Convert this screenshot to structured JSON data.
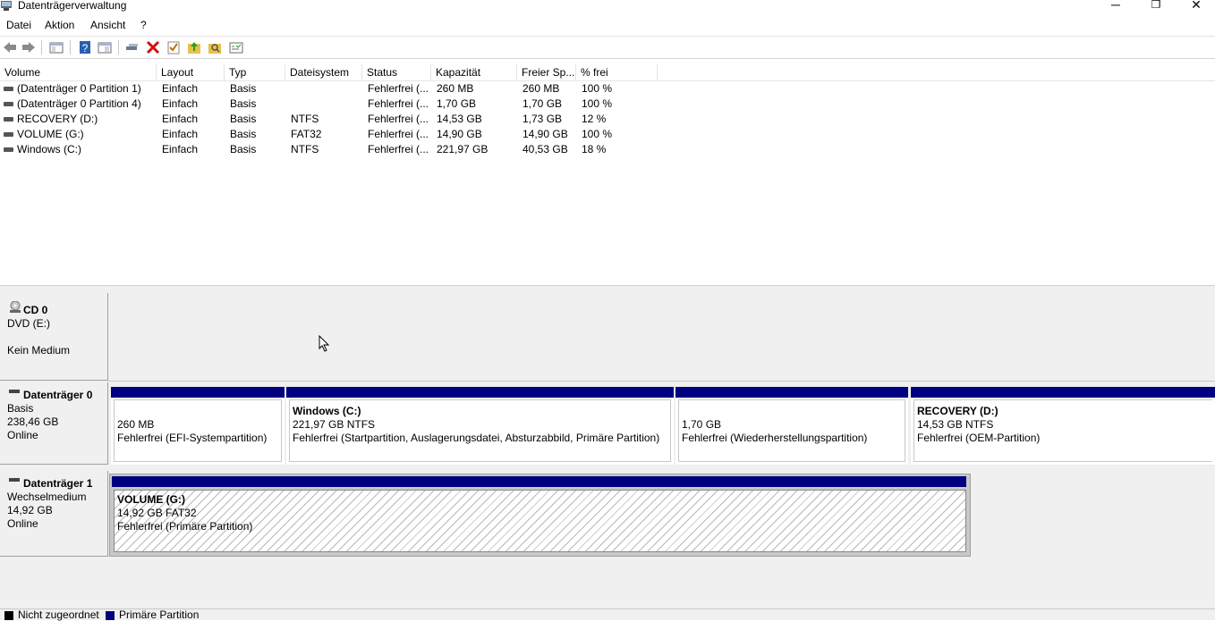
{
  "window": {
    "title": "Datenträgerverwaltung",
    "minimize": "─",
    "restore": "❐",
    "close": "✕"
  },
  "menu": [
    "Datei",
    "Aktion",
    "Ansicht",
    "?"
  ],
  "toolbar": [
    "back-icon",
    "forward-icon",
    "console-tree-icon",
    "help-icon",
    "properties-icon",
    "connect-icon",
    "delete-icon",
    "checkmark-icon",
    "up-folder-icon",
    "search-folder-icon",
    "show-hide-icon"
  ],
  "volume_list": {
    "columns": [
      "Volume",
      "Layout",
      "Typ",
      "Dateisystem",
      "Status",
      "Kapazität",
      "Freier Sp...",
      "% frei"
    ],
    "rows": [
      [
        "(Datenträger 0 Partition 1)",
        "Einfach",
        "Basis",
        "",
        "Fehlerfrei (...",
        "260 MB",
        "260 MB",
        "100 %"
      ],
      [
        "(Datenträger 0 Partition 4)",
        "Einfach",
        "Basis",
        "",
        "Fehlerfrei (...",
        "1,70 GB",
        "1,70 GB",
        "100 %"
      ],
      [
        "RECOVERY (D:)",
        "Einfach",
        "Basis",
        "NTFS",
        "Fehlerfrei (...",
        "14,53 GB",
        "1,73 GB",
        "12 %"
      ],
      [
        "VOLUME (G:)",
        "Einfach",
        "Basis",
        "FAT32",
        "Fehlerfrei (...",
        "14,90 GB",
        "14,90 GB",
        "100 %"
      ],
      [
        "Windows (C:)",
        "Einfach",
        "Basis",
        "NTFS",
        "Fehlerfrei (...",
        "221,97 GB",
        "40,53 GB",
        "18 %"
      ]
    ]
  },
  "disks": {
    "cd0": {
      "name": "CD 0",
      "line1": "DVD (E:)",
      "line2": "Kein Medium"
    },
    "disk0": {
      "name": "Datenträger 0",
      "type": "Basis",
      "size": "238,46 GB",
      "state": "Online",
      "partitions": [
        {
          "title": "",
          "line1": "260 MB",
          "line2": "Fehlerfrei (EFI-Systempartition)"
        },
        {
          "title": "Windows  (C:)",
          "line1": "221,97 GB NTFS",
          "line2": "Fehlerfrei (Startpartition, Auslagerungsdatei, Absturzabbild, Primäre Partition)"
        },
        {
          "title": "",
          "line1": "1,70 GB",
          "line2": "Fehlerfrei (Wiederherstellungspartition)"
        },
        {
          "title": "RECOVERY  (D:)",
          "line1": "14,53 GB NTFS",
          "line2": "Fehlerfrei (OEM-Partition)"
        }
      ]
    },
    "disk1": {
      "name": "Datenträger 1",
      "type": "Wechselmedium",
      "size": "14,92 GB",
      "state": "Online",
      "partitions": [
        {
          "title": "VOLUME  (G:)",
          "line1": "14,92 GB FAT32",
          "line2": "Fehlerfrei (Primäre Partition)"
        }
      ]
    }
  },
  "legend": {
    "unallocated": "Nicht zugeordnet",
    "primary": "Primäre Partition",
    "unallocated_color": "#000000",
    "primary_color": "#000080"
  }
}
